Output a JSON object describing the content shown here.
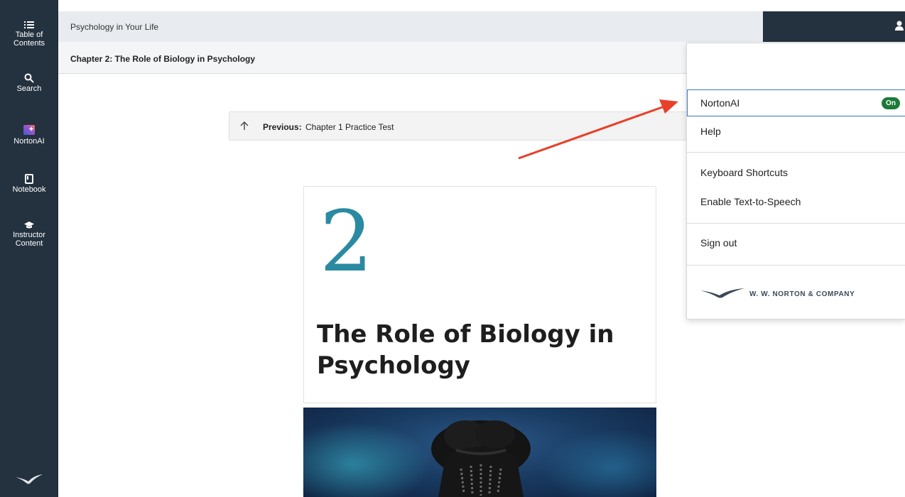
{
  "rail": {
    "items": [
      {
        "label": "Table of Contents"
      },
      {
        "label": "Search"
      },
      {
        "label": "NortonAI"
      },
      {
        "label": "Notebook"
      },
      {
        "label": "Instructor Content"
      }
    ]
  },
  "header": {
    "book_title": "Psychology in Your Life",
    "chapter_title": "Chapter 2: The Role of Biology in Psychology"
  },
  "previous": {
    "label": "Previous:",
    "target": "Chapter 1 Practice Test"
  },
  "chapter": {
    "number": "2",
    "heading": "The Role of Biology in Psychology"
  },
  "menu": {
    "items": [
      {
        "label": "NortonAI",
        "badge": "On"
      },
      {
        "label": "Help"
      },
      {
        "label": "Keyboard Shortcuts"
      },
      {
        "label": "Enable Text-to-Speech"
      },
      {
        "label": "Sign out"
      }
    ],
    "logo_text": "W. W. NORTON & COMPANY"
  },
  "colors": {
    "rail_bg": "#243240",
    "accent_number": "#2a8aa1",
    "badge_green": "#1c7a36",
    "focus_blue": "#3a78c2",
    "annotation_arrow": "#e8402a"
  },
  "icons": {
    "toc": "list-icon",
    "search": "search-icon",
    "nortonai": "nortonai-icon",
    "notebook": "notebook-icon",
    "instructor": "graduation-cap-icon",
    "previous": "arrow-up-icon",
    "account": "user-icon",
    "brand": "norton-seagull-logo"
  }
}
